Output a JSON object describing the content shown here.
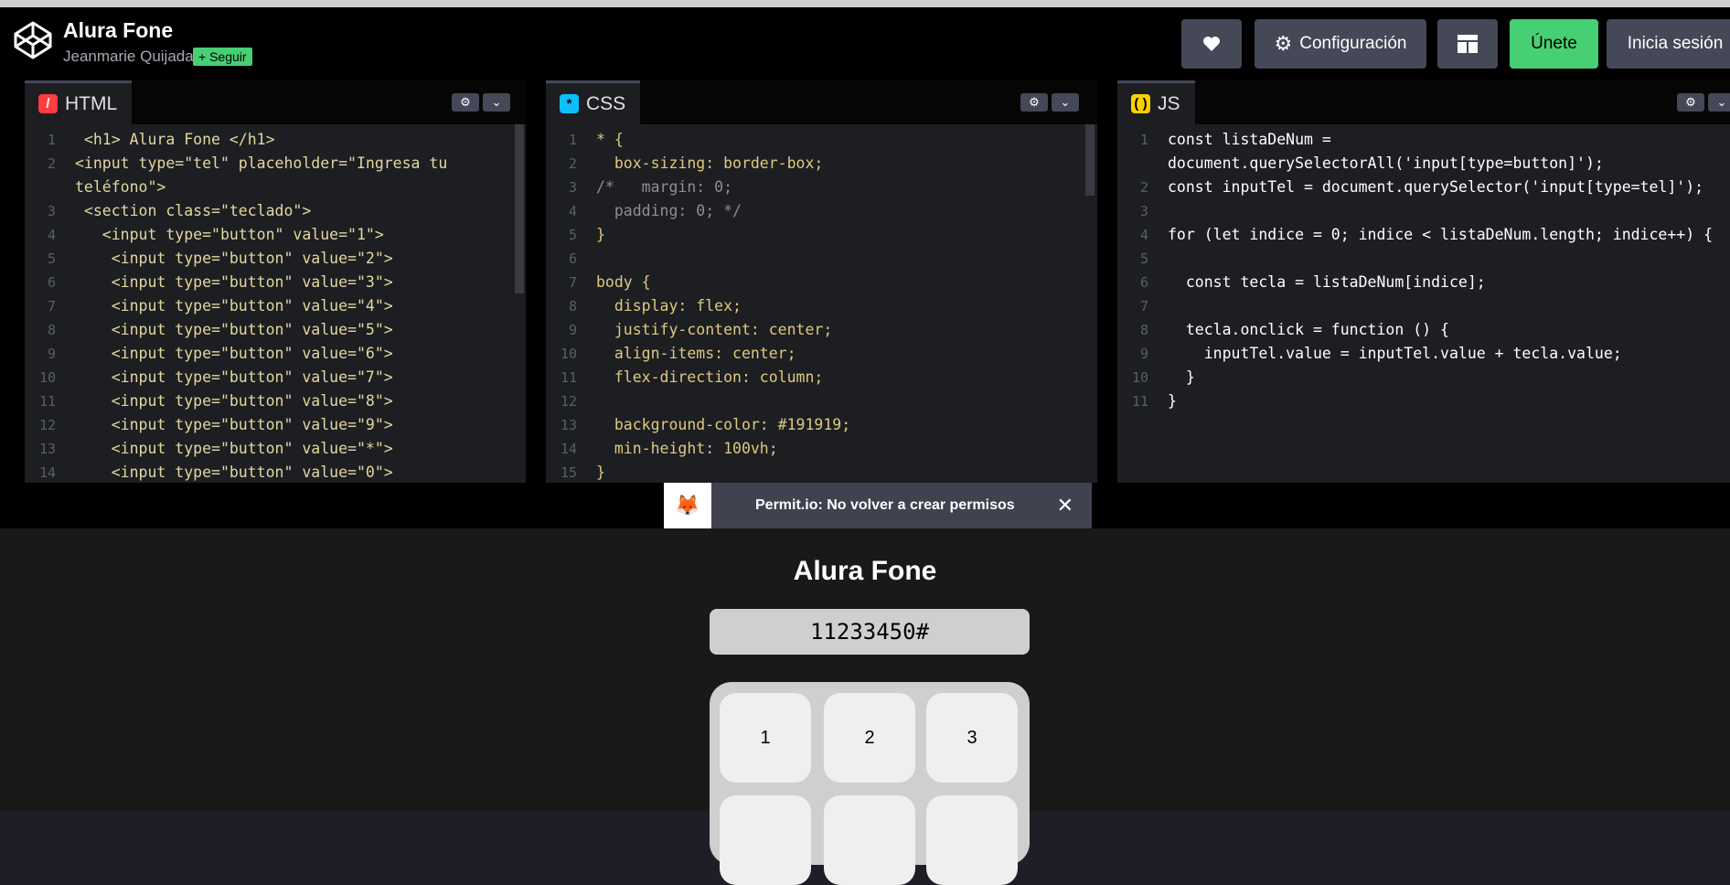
{
  "header": {
    "title": "Alura Fone",
    "author": "Jeanmarie Quijada",
    "follow_label": "Seguir",
    "config_label": "Configuración",
    "join_label": "Únete",
    "login_label": "Inicia sesión"
  },
  "editors": {
    "html": {
      "label": "HTML",
      "lines": [
        {
          "n": "1",
          "t": " <h1> Alura Fone </h1>"
        },
        {
          "n": "2",
          "t": "<input type=\"tel\" placeholder=\"Ingresa tu"
        },
        {
          "n": "",
          "t": "teléfono\">"
        },
        {
          "n": "3",
          "t": " <section class=\"teclado\">"
        },
        {
          "n": "4",
          "t": "   <input type=\"button\" value=\"1\">"
        },
        {
          "n": "5",
          "t": "    <input type=\"button\" value=\"2\">"
        },
        {
          "n": "6",
          "t": "    <input type=\"button\" value=\"3\">"
        },
        {
          "n": "7",
          "t": "    <input type=\"button\" value=\"4\">"
        },
        {
          "n": "8",
          "t": "    <input type=\"button\" value=\"5\">"
        },
        {
          "n": "9",
          "t": "    <input type=\"button\" value=\"6\">"
        },
        {
          "n": "10",
          "t": "    <input type=\"button\" value=\"7\">"
        },
        {
          "n": "11",
          "t": "    <input type=\"button\" value=\"8\">"
        },
        {
          "n": "12",
          "t": "    <input type=\"button\" value=\"9\">"
        },
        {
          "n": "13",
          "t": "    <input type=\"button\" value=\"*\">"
        },
        {
          "n": "14",
          "t": "    <input type=\"button\" value=\"0\">"
        }
      ]
    },
    "css": {
      "label": "CSS",
      "lines": [
        {
          "n": "1",
          "t": "* {"
        },
        {
          "n": "2",
          "t": "  box-sizing: border-box;"
        },
        {
          "n": "3",
          "t": "/*   margin: 0;"
        },
        {
          "n": "4",
          "t": "  padding: 0; */"
        },
        {
          "n": "5",
          "t": "}"
        },
        {
          "n": "6",
          "t": ""
        },
        {
          "n": "7",
          "t": "body {"
        },
        {
          "n": "8",
          "t": "  display: flex;"
        },
        {
          "n": "9",
          "t": "  justify-content: center;"
        },
        {
          "n": "10",
          "t": "  align-items: center;"
        },
        {
          "n": "11",
          "t": "  flex-direction: column;"
        },
        {
          "n": "12",
          "t": ""
        },
        {
          "n": "13",
          "t": "  background-color: #191919;"
        },
        {
          "n": "14",
          "t": "  min-height: 100vh;"
        },
        {
          "n": "15",
          "t": "}"
        }
      ]
    },
    "js": {
      "label": "JS",
      "lines": [
        {
          "n": "1",
          "t": "const listaDeNum ="
        },
        {
          "n": "",
          "t": "document.querySelectorAll('input[type=button]');"
        },
        {
          "n": "2",
          "t": "const inputTel = document.querySelector('input[type=tel]');"
        },
        {
          "n": "3",
          "t": ""
        },
        {
          "n": "4",
          "t": "for (let indice = 0; indice < listaDeNum.length; indice++) {"
        },
        {
          "n": "5",
          "t": ""
        },
        {
          "n": "6",
          "t": "  const tecla = listaDeNum[indice];"
        },
        {
          "n": "7",
          "t": ""
        },
        {
          "n": "8",
          "t": "  tecla.onclick = function () {"
        },
        {
          "n": "9",
          "t": "    inputTel.value = inputTel.value + tecla.value;"
        },
        {
          "n": "10",
          "t": "  }"
        },
        {
          "n": "11",
          "t": "}"
        }
      ]
    }
  },
  "ad": {
    "text": "Permit.io: No volver a crear permisos"
  },
  "preview": {
    "title": "Alura Fone",
    "tel_value": "11233450#",
    "keys": [
      "1",
      "2",
      "3"
    ]
  }
}
